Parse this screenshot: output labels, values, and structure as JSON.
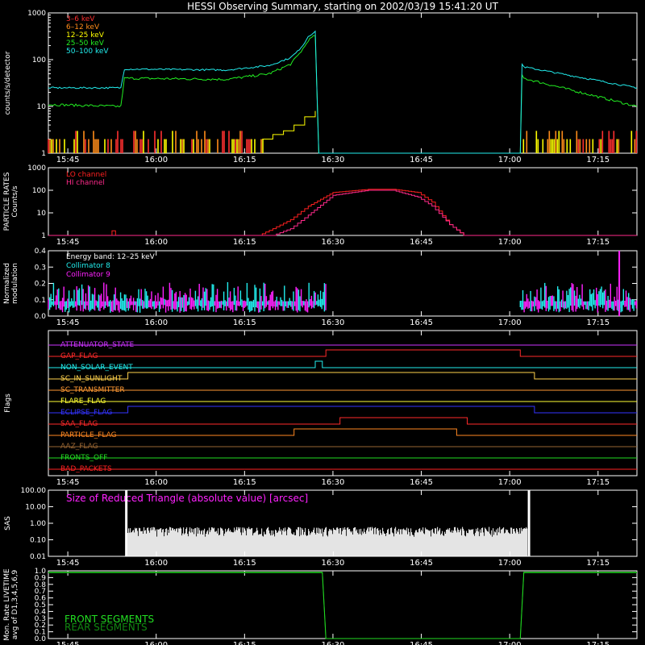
{
  "title": "HESSI Observing Summary, starting on 2002/03/19 15:41:20 UT",
  "time_ticks": [
    "15:45",
    "16:00",
    "16:15",
    "16:30",
    "16:45",
    "17:00",
    "17:15"
  ],
  "colors": {
    "bg": "#000000",
    "axis": "#ffffff",
    "e3_6": "#ff3030",
    "e6_12": "#ff8c1a",
    "e12_25": "#ffff00",
    "e25_50": "#22ee22",
    "e50_100": "#22eeee",
    "lo": "#ff2020",
    "hi": "#ff2a8a",
    "cyan": "#22eeee",
    "magenta": "#ff22ff",
    "green": "#22dd22",
    "darkgreen": "#118811"
  },
  "chart_data": [
    {
      "id": "count-rates",
      "type": "line",
      "ylabel": "counts/s/detector",
      "yscale": "log",
      "ylim": [
        1,
        1000
      ],
      "yticks": [
        "1",
        "10",
        "100",
        "1000"
      ],
      "legend": [
        "3–6 keV",
        "6–12 keV",
        "12–25 keV",
        "25–50 keV",
        "50–100 keV"
      ],
      "series": [
        {
          "name": "50–100 keV",
          "color": "e50_100",
          "x": [
            15.695,
            15.9,
            15.91,
            16.2,
            16.32,
            16.38,
            16.4,
            16.42,
            16.43,
            16.45,
            16.46,
            16.47,
            16.48,
            16.49,
            17.03,
            17.035,
            17.04,
            17.36
          ],
          "y": [
            25,
            25,
            63,
            60,
            75,
            110,
            150,
            230,
            320,
            390,
            1,
            1,
            1,
            1,
            1,
            80,
            70,
            25
          ]
        },
        {
          "name": "25–50 keV",
          "color": "e25_50",
          "x": [
            15.695,
            15.9,
            15.91,
            16.2,
            16.32,
            16.38,
            16.4,
            16.42,
            16.43,
            16.45,
            16.46,
            16.47,
            16.48,
            16.49,
            17.03,
            17.035,
            17.04,
            17.36
          ],
          "y": [
            11,
            10,
            40,
            38,
            50,
            80,
            120,
            190,
            260,
            330,
            1,
            1,
            1,
            1,
            1,
            45,
            40,
            10
          ]
        },
        {
          "name": "12–25 keV",
          "color": "e12_25",
          "x": [
            16.3,
            16.33,
            16.36,
            16.39,
            16.42,
            16.45
          ],
          "y": [
            2,
            2.5,
            3,
            4,
            6,
            8
          ]
        }
      ]
    },
    {
      "id": "particle-rates",
      "type": "line",
      "ylabel": "PARTICLE RATES Counts/s",
      "yscale": "log",
      "ylim": [
        1,
        1000
      ],
      "yticks": [
        "1",
        "10",
        "100",
        "1000"
      ],
      "legend": [
        "LO channel",
        "HI channel"
      ],
      "series": [
        {
          "name": "LO channel",
          "color": "lo",
          "x": [
            15.695,
            16.29,
            16.33,
            16.38,
            16.43,
            16.5,
            16.6,
            16.67,
            16.74,
            16.78,
            16.83,
            16.87,
            17.36
          ],
          "y": [
            1,
            1,
            2,
            5,
            20,
            80,
            110,
            110,
            80,
            30,
            3,
            1,
            1
          ]
        },
        {
          "name": "HI channel",
          "color": "hi",
          "x": [
            15.695,
            16.33,
            16.38,
            16.43,
            16.5,
            16.6,
            16.67,
            16.74,
            16.78,
            16.83,
            16.87,
            17.36
          ],
          "y": [
            1,
            1,
            2,
            8,
            60,
            100,
            100,
            50,
            20,
            3,
            1,
            1
          ]
        }
      ]
    },
    {
      "id": "modulation",
      "type": "line",
      "ylabel": "Normalized modulation",
      "ylim": [
        0,
        0.4
      ],
      "yticks": [
        "0.0",
        "0.1",
        "0.2",
        "0.3",
        "0.4"
      ],
      "legend": [
        "Energy band: 12–25 keV",
        "Collimator 8",
        "Collimator 9"
      ],
      "series": [
        {
          "name": "Collimator 8",
          "color": "cyan",
          "x": [
            15.695,
            16.48,
            17.03,
            17.36
          ],
          "y": [
            0.08,
            0.08,
            0.08,
            0.08
          ]
        },
        {
          "name": "Collimator 9",
          "color": "magenta",
          "x": [
            15.695,
            16.48,
            17.03,
            17.36
          ],
          "y": [
            0.07,
            0.07,
            0.07,
            0.07
          ]
        }
      ]
    },
    {
      "id": "flags",
      "type": "line",
      "ylabel": "Flags",
      "flags": [
        {
          "name": "ATTENUATOR_STATE",
          "color": "#cc33ff",
          "changes": []
        },
        {
          "name": "GAP_FLAG",
          "color": "#ff2a2a",
          "changes": [
            16.48,
            17.03
          ]
        },
        {
          "name": "NON_SOLAR_EVENT",
          "color": "#22eeee",
          "changes": [
            16.45,
            16.47
          ]
        },
        {
          "name": "SC_IN_SUNLIGHT",
          "color": "#ffd24d",
          "changes": [
            15.92,
            17.07
          ]
        },
        {
          "name": "SC_TRANSMITTER",
          "color": "#ff9933",
          "changes": []
        },
        {
          "name": "FLARE_FLAG",
          "color": "#ffff33",
          "changes": []
        },
        {
          "name": "ECLIPSE_FLAG",
          "color": "#3333ff",
          "changes": [
            15.92,
            17.07
          ]
        },
        {
          "name": "SAA_FLAG",
          "color": "#ff2a2a",
          "changes": [
            16.52,
            16.88
          ]
        },
        {
          "name": "PARTICLE_FLAG",
          "color": "#ff8822",
          "changes": [
            16.39,
            16.85
          ]
        },
        {
          "name": "AAZ_FLAG",
          "color": "#996633",
          "changes": []
        },
        {
          "name": "FRONTS_OFF",
          "color": "#22dd22",
          "changes": []
        },
        {
          "name": "BAD_PACKETS",
          "color": "#ff2222",
          "changes": []
        }
      ]
    },
    {
      "id": "sas",
      "type": "bar",
      "ylabel": "SAS",
      "yscale": "log",
      "ylim": [
        0.01,
        100
      ],
      "yticks": [
        "0.01",
        "0.10",
        "1.00",
        "10.00",
        "100.00"
      ],
      "annotation": "Size of Reduced Triangle (absolute value) [arcsec]",
      "series": [
        {
          "name": "SAS",
          "color": "#ffffff",
          "x": [
            15.92,
            17.05
          ],
          "y": [
            0.5,
            0.5
          ]
        }
      ]
    },
    {
      "id": "livetime",
      "type": "line",
      "ylabel": "Mon. Rate LIVETIME avg of D1,3,4,5,6,9",
      "ylim": [
        0,
        1
      ],
      "yticks": [
        "0.0",
        "0.1",
        "0.2",
        "0.3",
        "0.4",
        "0.5",
        "0.6",
        "0.7",
        "0.8",
        "0.9",
        "1.0"
      ],
      "legend": [
        "FRONT SEGMENTS",
        "REAR SEGMENTS"
      ],
      "series": [
        {
          "name": "FRONT SEGMENTS",
          "color": "green",
          "x": [
            15.695,
            16.47,
            16.48,
            17.03,
            17.04,
            17.36
          ],
          "y": [
            0.98,
            0.98,
            0,
            0,
            0.98,
            0.98
          ]
        },
        {
          "name": "REAR SEGMENTS",
          "color": "darkgreen",
          "x": [
            15.695,
            16.47,
            16.48,
            17.03,
            17.04,
            17.36
          ],
          "y": [
            0.97,
            0.97,
            0,
            0,
            0.97,
            0.97
          ]
        }
      ]
    }
  ]
}
